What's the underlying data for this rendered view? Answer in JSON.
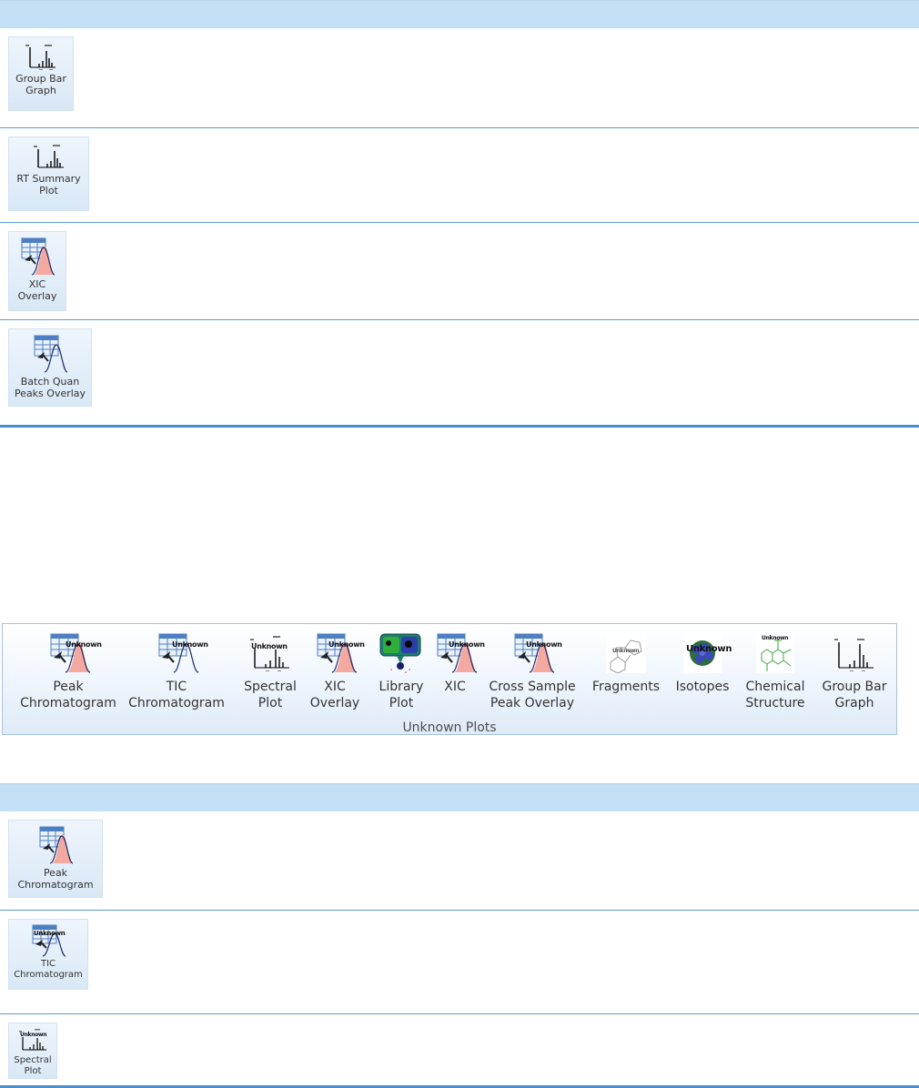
{
  "top_table": {
    "rows": [
      {
        "label": "Group Bar\nGraph",
        "icon": "group-bar-graph-icon"
      },
      {
        "label": "RT Summary\nPlot",
        "icon": "rt-summary-plot-icon"
      },
      {
        "label": "XIC\nOverlay",
        "icon": "xic-overlay-icon"
      },
      {
        "label": "Batch Quan\nPeaks Overlay",
        "icon": "batch-quan-peaks-overlay-icon"
      }
    ]
  },
  "ribbon": {
    "group_label": "Unknown Plots",
    "unknown_text": "Unknown",
    "items": [
      {
        "label": "Peak\nChromatogram",
        "icon": "peak-chromatogram-icon"
      },
      {
        "label": "TIC\nChromatogram",
        "icon": "tic-chromatogram-icon"
      },
      {
        "label": "Spectral\nPlot",
        "icon": "spectral-plot-icon"
      },
      {
        "label": "XIC\nOverlay",
        "icon": "xic-overlay-icon"
      },
      {
        "label": "Library\nPlot",
        "icon": "library-plot-icon"
      },
      {
        "label": "XIC",
        "icon": "xic-icon"
      },
      {
        "label": "Cross Sample\nPeak Overlay",
        "icon": "cross-sample-peak-overlay-icon"
      },
      {
        "label": "Fragments",
        "icon": "fragments-icon"
      },
      {
        "label": "Isotopes",
        "icon": "isotopes-icon"
      },
      {
        "label": "Chemical\nStructure",
        "icon": "chemical-structure-icon"
      },
      {
        "label": "Group Bar\nGraph",
        "icon": "group-bar-graph-icon"
      }
    ]
  },
  "bottom_table": {
    "rows": [
      {
        "label": "Peak\nChromatogram",
        "icon": "peak-chromatogram-icon"
      },
      {
        "label": "TIC\nChromatogram",
        "icon": "tic-chromatogram-icon"
      },
      {
        "label": "Spectral\nPlot",
        "icon": "spectral-plot-icon"
      }
    ]
  },
  "colors": {
    "header_bg": "#c5dff5",
    "row_border": "#5b9bd5",
    "button_bg": "#dfeaf6",
    "peak_fill": "#f4a9a0",
    "peak_stroke": "#1f2a6b",
    "grid_blue": "#4f7fc3"
  }
}
